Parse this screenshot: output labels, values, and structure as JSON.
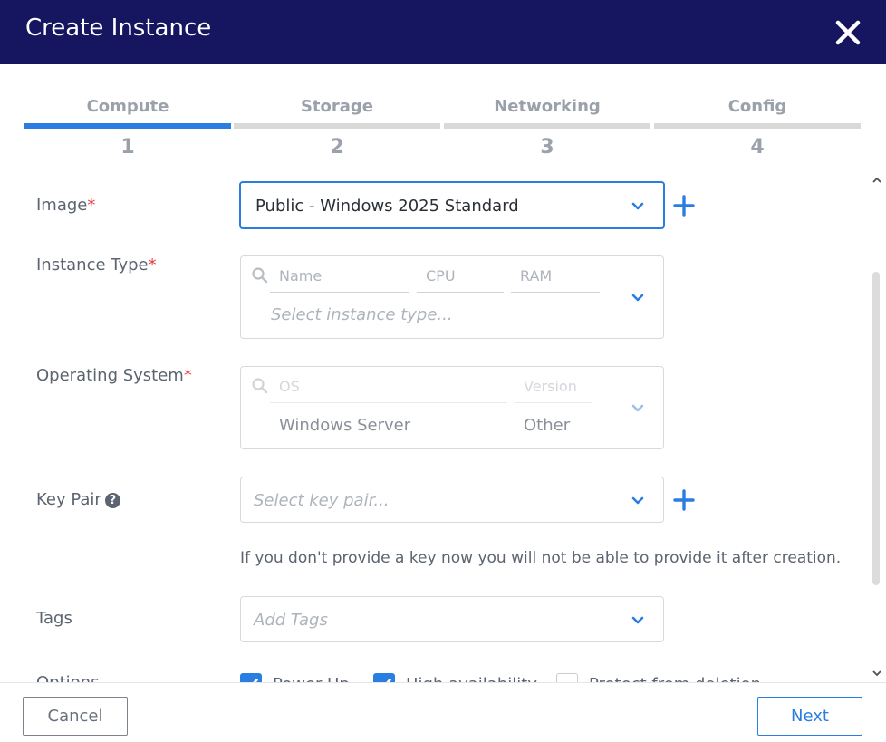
{
  "window": {
    "title": "Create Instance",
    "close_icon": "close-icon"
  },
  "steps": [
    {
      "label": "Compute",
      "number": "1",
      "active": true
    },
    {
      "label": "Storage",
      "number": "2",
      "active": false
    },
    {
      "label": "Networking",
      "number": "3",
      "active": false
    },
    {
      "label": "Config",
      "number": "4",
      "active": false
    }
  ],
  "form": {
    "image": {
      "label": "Image",
      "required_mark": "*",
      "value": "Public - Windows 2025 Standard"
    },
    "instance_type": {
      "label": "Instance Type",
      "required_mark": "*",
      "columns": [
        "Name",
        "CPU",
        "RAM"
      ],
      "placeholder": "Select instance type..."
    },
    "operating_system": {
      "label": "Operating System",
      "required_mark": "*",
      "columns": [
        "OS",
        "Version"
      ],
      "values": [
        "Windows Server",
        "Other"
      ]
    },
    "key_pair": {
      "label": "Key Pair",
      "help_icon": "?",
      "placeholder": "Select key pair...",
      "hint": "If you don't provide a key now you will not be able to provide it after creation."
    },
    "tags": {
      "label": "Tags",
      "placeholder": "Add Tags"
    },
    "options": {
      "label": "Options",
      "items": [
        {
          "label": "Power Up",
          "checked": true
        },
        {
          "label": "High availability",
          "checked": true
        },
        {
          "label": "Protect from deletion",
          "checked": false
        }
      ]
    }
  },
  "footer": {
    "cancel_label": "Cancel",
    "next_label": "Next"
  },
  "colors": {
    "header_bg": "#161660",
    "accent": "#2a7de1",
    "required": "#e53c3c"
  }
}
